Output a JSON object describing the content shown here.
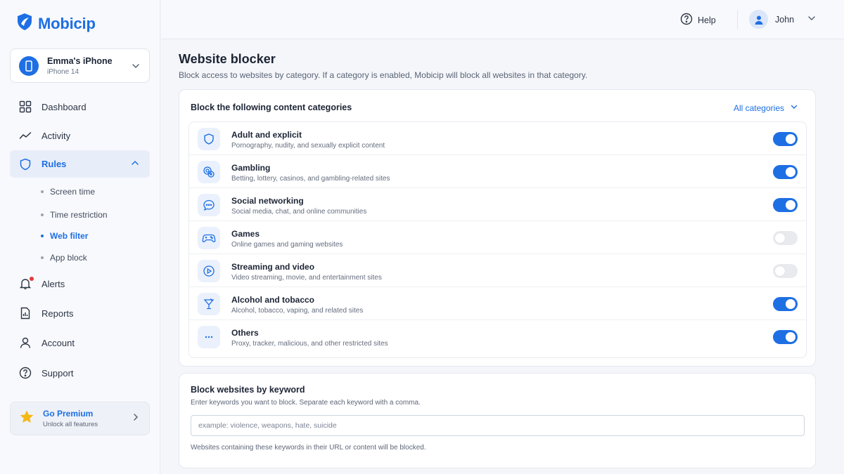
{
  "brand": {
    "name": "Mobicip",
    "color": "#1e6fe3"
  },
  "device": {
    "name": "Emma's iPhone",
    "model": "iPhone 14"
  },
  "nav": {
    "dashboard": "Dashboard",
    "activity": "Activity",
    "rules": "Rules",
    "rules_sub": [
      "Screen time",
      "Time restriction",
      "Web filter",
      "App block"
    ],
    "alerts": "Alerts",
    "reports": "Reports",
    "account": "Account",
    "support": "Support"
  },
  "premium": {
    "title": "Go Premium",
    "subtitle": "Unlock all features"
  },
  "header": {
    "help": "Help",
    "user": "John"
  },
  "page": {
    "title": "Website blocker",
    "description": "Block access to websites by category. If a category is enabled, Mobicip will block all websites in that category."
  },
  "categories_card": {
    "title": "Block the following content categories",
    "filter": "All categories",
    "items": [
      {
        "title": "Adult and explicit",
        "desc": "Pornography, nudity, and sexually explicit content",
        "enabled": true,
        "icon": "shield-icon"
      },
      {
        "title": "Gambling",
        "desc": "Betting, lottery, casinos, and gambling-related sites",
        "enabled": true,
        "icon": "chips-icon"
      },
      {
        "title": "Social networking",
        "desc": "Social media, chat, and online communities",
        "enabled": true,
        "icon": "chat-bubble-icon"
      },
      {
        "title": "Games",
        "desc": "Online games and gaming websites",
        "enabled": false,
        "icon": "gamepad-icon"
      },
      {
        "title": "Streaming and video",
        "desc": "Video streaming, movie, and entertainment sites",
        "enabled": false,
        "icon": "play-icon"
      },
      {
        "title": "Alcohol and tobacco",
        "desc": "Alcohol, tobacco, vaping, and related sites",
        "enabled": true,
        "icon": "cocktail-icon"
      },
      {
        "title": "Others",
        "desc": "Proxy, tracker, malicious, and other restricted sites",
        "enabled": true,
        "icon": "more-icon"
      }
    ]
  },
  "keyword_card": {
    "title": "Block websites by keyword",
    "description": "Enter keywords you want to block. Separate each keyword with a comma.",
    "input_value": "",
    "placeholder": "example: violence, weapons, hate, suicide",
    "note": "Websites containing these keywords in their URL or content will be blocked."
  }
}
